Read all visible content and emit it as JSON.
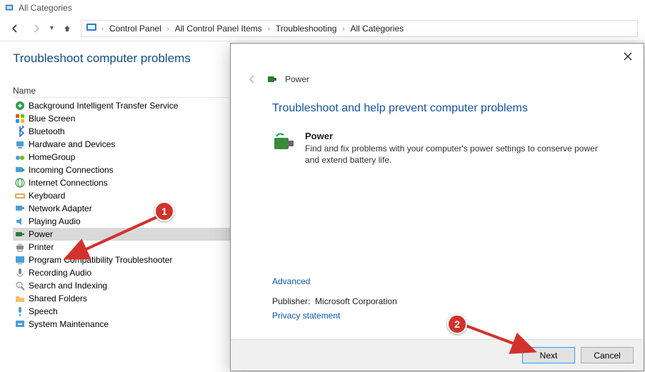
{
  "window": {
    "title": "All Categories"
  },
  "breadcrumbs": {
    "items": [
      "Control Panel",
      "All Control Panel Items",
      "Troubleshooting",
      "All Categories"
    ]
  },
  "page": {
    "heading": "Troubleshoot computer problems",
    "column_name": "Name"
  },
  "items": [
    {
      "label": "Background Intelligent Transfer Service",
      "icon": "bits-icon"
    },
    {
      "label": "Blue Screen",
      "icon": "windows-icon"
    },
    {
      "label": "Bluetooth",
      "icon": "bluetooth-icon"
    },
    {
      "label": "Hardware and Devices",
      "icon": "hardware-icon"
    },
    {
      "label": "HomeGroup",
      "icon": "homegroup-icon"
    },
    {
      "label": "Incoming Connections",
      "icon": "incoming-icon"
    },
    {
      "label": "Internet Connections",
      "icon": "internet-icon"
    },
    {
      "label": "Keyboard",
      "icon": "keyboard-icon"
    },
    {
      "label": "Network Adapter",
      "icon": "adapter-icon"
    },
    {
      "label": "Playing Audio",
      "icon": "audio-icon"
    },
    {
      "label": "Power",
      "icon": "power-icon",
      "selected": true
    },
    {
      "label": "Printer",
      "icon": "printer-icon"
    },
    {
      "label": "Program Compatibility Troubleshooter",
      "icon": "compat-icon"
    },
    {
      "label": "Recording Audio",
      "icon": "recaudio-icon"
    },
    {
      "label": "Search and Indexing",
      "icon": "search-icon"
    },
    {
      "label": "Shared Folders",
      "icon": "sharedfolders-icon"
    },
    {
      "label": "Speech",
      "icon": "speech-icon"
    },
    {
      "label": "System Maintenance",
      "icon": "maintenance-icon"
    }
  ],
  "dialog": {
    "header_title": "Power",
    "heading": "Troubleshoot and help prevent computer problems",
    "ts_name": "Power",
    "ts_desc": "Find and fix problems with your computer's power settings to conserve power and extend battery life.",
    "advanced": "Advanced",
    "publisher_label": "Publisher:",
    "publisher_value": "Microsoft Corporation",
    "privacy": "Privacy statement",
    "next": "Next",
    "cancel": "Cancel"
  },
  "annotations": {
    "one": "1",
    "two": "2"
  }
}
